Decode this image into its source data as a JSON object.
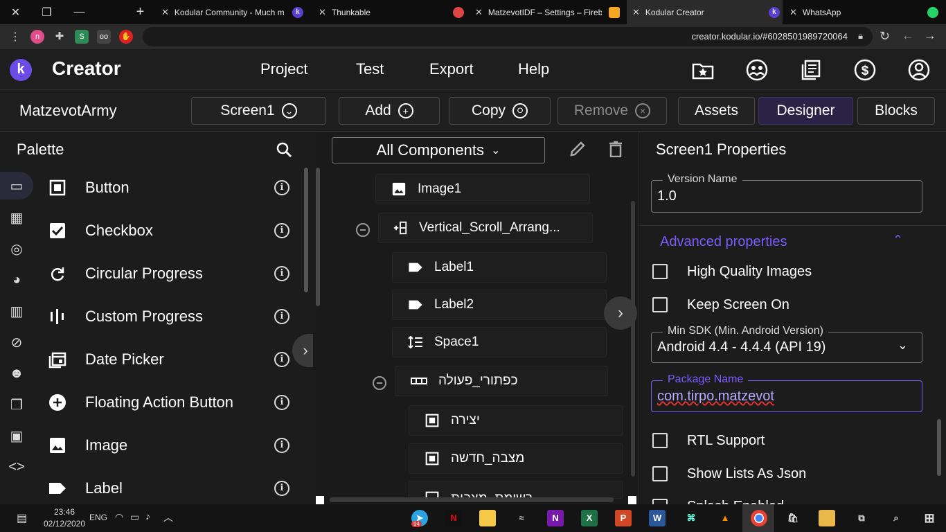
{
  "browser": {
    "tabs": [
      {
        "title": "Kodular Community - Much m",
        "active": false
      },
      {
        "title": "Thunkable",
        "active": false
      },
      {
        "title": "MatzevotIDF – Settings – Fireb",
        "active": false
      },
      {
        "title": "Kodular Creator",
        "active": true
      },
      {
        "title": "WhatsApp",
        "active": false
      }
    ],
    "url": "creator.kodular.io/#6028501989720064",
    "new_tab": "+"
  },
  "app": {
    "logo_letter": "k",
    "brand": "Creator",
    "menu": [
      "Project",
      "Test",
      "Export",
      "Help"
    ],
    "accent": "#7b5cff"
  },
  "toolbar": {
    "project_name": "MatzevotArmy",
    "screen": "Screen1",
    "add": "Add",
    "copy": "Copy",
    "remove": "Remove",
    "assets": "Assets",
    "designer": "Designer",
    "blocks": "Blocks"
  },
  "palette": {
    "title": "Palette",
    "items": [
      {
        "label": "Button",
        "icon": "button-icon"
      },
      {
        "label": "Checkbox",
        "icon": "checkbox-icon"
      },
      {
        "label": "Circular Progress",
        "icon": "refresh-icon"
      },
      {
        "label": "Custom Progress",
        "icon": "bars-icon"
      },
      {
        "label": "Date Picker",
        "icon": "calendar-icon"
      },
      {
        "label": "Floating Action Button",
        "icon": "add-circle-icon"
      },
      {
        "label": "Image",
        "icon": "image-icon"
      },
      {
        "label": "Label",
        "icon": "label-icon"
      }
    ]
  },
  "components": {
    "filter": "All Components",
    "nodes": [
      {
        "label": "Image1",
        "icon": "image-icon"
      },
      {
        "label": "Vertical_Scroll_Arrang...",
        "icon": "vertical-arrangement-icon"
      },
      {
        "label": "Label1",
        "icon": "label-icon"
      },
      {
        "label": "Label2",
        "icon": "label-icon"
      },
      {
        "label": "Space1",
        "icon": "space-icon"
      },
      {
        "label": "כפתורי_פעולה",
        "icon": "horizontal-arrangement-icon"
      },
      {
        "label": "יצירה",
        "icon": "button-icon"
      },
      {
        "label": "מצבה_חדשה",
        "icon": "button-icon"
      },
      {
        "label": "רשימת_מצבות",
        "icon": "button-icon"
      }
    ]
  },
  "properties": {
    "title": "Screen1 Properties",
    "version_name_label": "Version Name",
    "version_name": "1.0",
    "advanced": "Advanced properties",
    "checks": [
      {
        "label": "High Quality Images",
        "checked": false
      },
      {
        "label": "Keep Screen On",
        "checked": false
      },
      {
        "label": "RTL Support",
        "checked": false
      },
      {
        "label": "Show Lists As Json",
        "checked": false
      },
      {
        "label": "Splash Enabled",
        "checked": false
      }
    ],
    "min_sdk_label": "Min SDK (Min. Android Version)",
    "min_sdk": "Android 4.4 - 4.4.4 (API 19)",
    "package_label": "Package Name",
    "package": "com.tirpo.matzevot"
  },
  "taskbar": {
    "time": "23:46",
    "date": "02/12/2020",
    "lang": "ENG",
    "telegram_badge": "94"
  }
}
